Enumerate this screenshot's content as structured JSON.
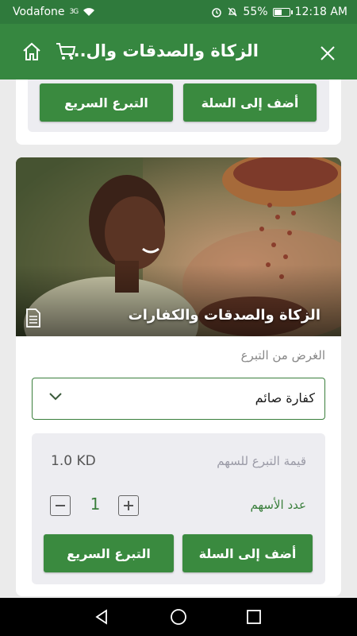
{
  "status_bar": {
    "carrier": "Vodafone",
    "network": "3G",
    "battery": "55%",
    "battery_level": 0.55,
    "time": "12:18 AM"
  },
  "app_bar": {
    "title": "الزكاة والصدقات وال...",
    "icons": [
      "home-icon",
      "cart-icon",
      "close-icon"
    ]
  },
  "top_card": {
    "add_to_cart_label": "أضف إلى السلة",
    "quick_donate_label": "التبرع السريع"
  },
  "project_card": {
    "image_caption": "الزكاة والصدقات والكفارات",
    "purpose_label": "الغرض من التبرع",
    "purpose_selected": "كفارة صائم",
    "share_value_label": "قيمة التبرع للسهم",
    "share_value": "1.0 KD",
    "shares_count_label": "عدد الأسهم",
    "quantity": "1",
    "add_to_cart_label": "أضف إلى السلة",
    "quick_donate_label": "التبرع السريع"
  },
  "colors": {
    "primary": "#368740",
    "button": "#3a8a3f",
    "panel": "#ededf1"
  }
}
